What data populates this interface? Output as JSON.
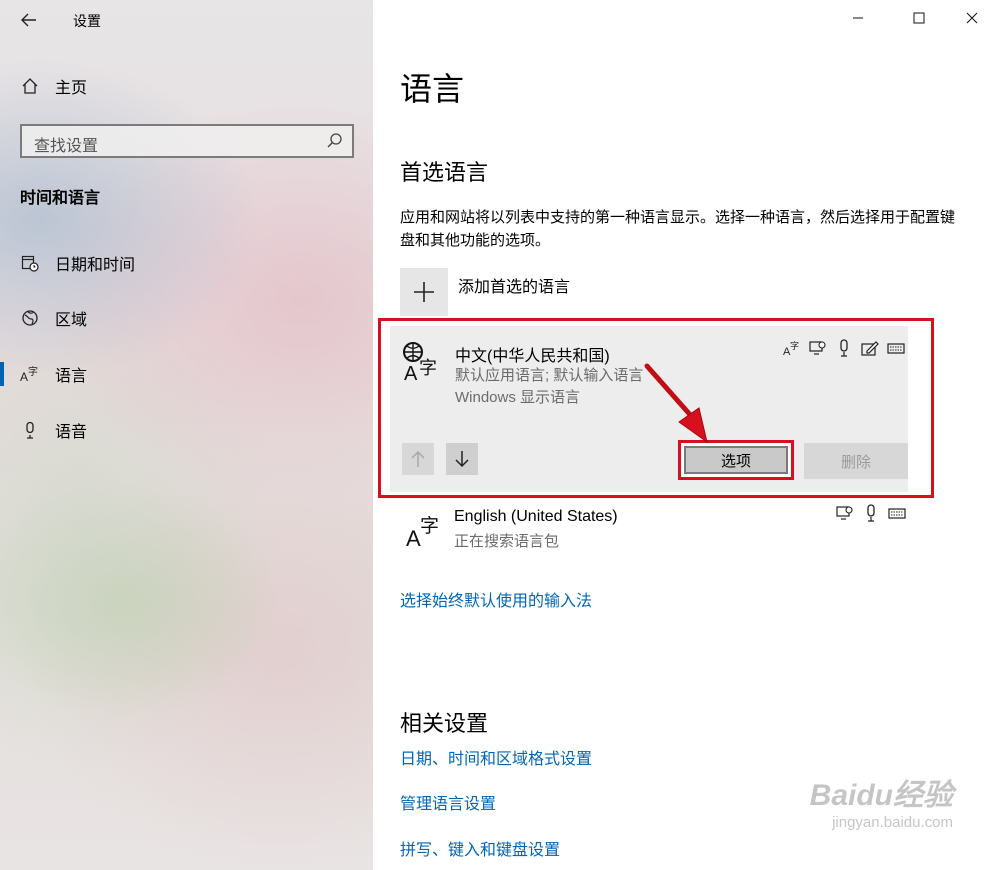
{
  "window": {
    "title": "设置"
  },
  "sidebar": {
    "home": "主页",
    "search_placeholder": "查找设置",
    "section": "时间和语言",
    "items": [
      {
        "label": "日期和时间",
        "icon": "calendar-clock-icon"
      },
      {
        "label": "区域",
        "icon": "globe-region-icon"
      },
      {
        "label": "语言",
        "icon": "language-icon",
        "selected": true
      },
      {
        "label": "语音",
        "icon": "microphone-icon"
      }
    ]
  },
  "main": {
    "title": "语言",
    "preferred_heading": "首选语言",
    "description": "应用和网站将以列表中支持的第一种语言显示。选择一种语言，然后选择用于配置键盘和其他功能的选项。",
    "add_language": "添加首选的语言",
    "languages": [
      {
        "name": "中文(中华人民共和国)",
        "sub1": "默认应用语言; 默认输入语言",
        "sub2": "Windows 显示语言",
        "features": [
          "language-pack-icon",
          "speech-recognition-icon",
          "microphone-icon",
          "handwriting-icon",
          "keyboard-icon"
        ]
      },
      {
        "name": "English (United States)",
        "sub1": "正在搜索语言包",
        "features": [
          "speech-recognition-icon",
          "microphone-icon",
          "keyboard-icon"
        ]
      }
    ],
    "options_button": "选项",
    "remove_button": "删除",
    "input_method_link": "选择始终默认使用的输入法",
    "related_heading": "相关设置",
    "related_links": [
      "日期、时间和区域格式设置",
      "管理语言设置",
      "拼写、键入和键盘设置"
    ]
  },
  "watermark": {
    "brand": "Baidu经验",
    "url": "jingyan.baidu.com"
  },
  "colors": {
    "accent": "#0067b8",
    "highlight": "#d8101e",
    "card": "#ededed"
  }
}
